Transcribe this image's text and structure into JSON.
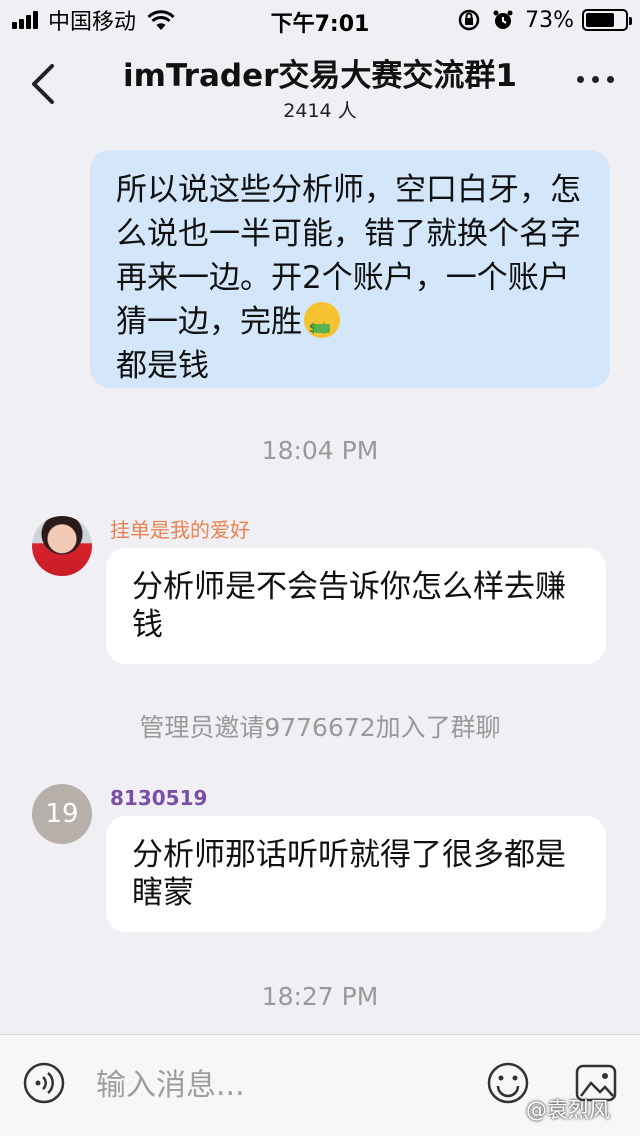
{
  "status_bar": {
    "carrier": "中国移动",
    "time": "下午7:01",
    "battery": "73%",
    "battery_level": 0.73
  },
  "header": {
    "title": "imTrader交易大赛交流群1",
    "subtitle": "2414 人"
  },
  "messages": {
    "outgoing": {
      "text": "所以说这些分析师，空口白牙，怎么说也一半可能，错了就换个名字再来一边。开2个账户，一个账户猜一边，完胜",
      "text_after_emoji": "都是钱",
      "emoji": "money-mouth-face"
    },
    "timestamp_1": "18:04 PM",
    "msg_1": {
      "sender": "挂单是我的爱好",
      "sender_color": "#e8834f",
      "text": "分析师是不会告诉你怎么样去赚钱"
    },
    "system_notice": "管理员邀请9776672加入了群聊",
    "msg_2": {
      "avatar_text": "19",
      "sender": "8130519",
      "sender_color": "#7a4fa8",
      "text": "分析师那话听听就得了很多都是瞎蒙"
    },
    "timestamp_2": "18:27 PM"
  },
  "input_bar": {
    "placeholder": "输入消息..."
  },
  "watermark": "@袁烈风",
  "colors": {
    "background": "#efeff4",
    "outgoing_bubble": "#d4e6f9",
    "incoming_bubble": "#ffffff"
  }
}
